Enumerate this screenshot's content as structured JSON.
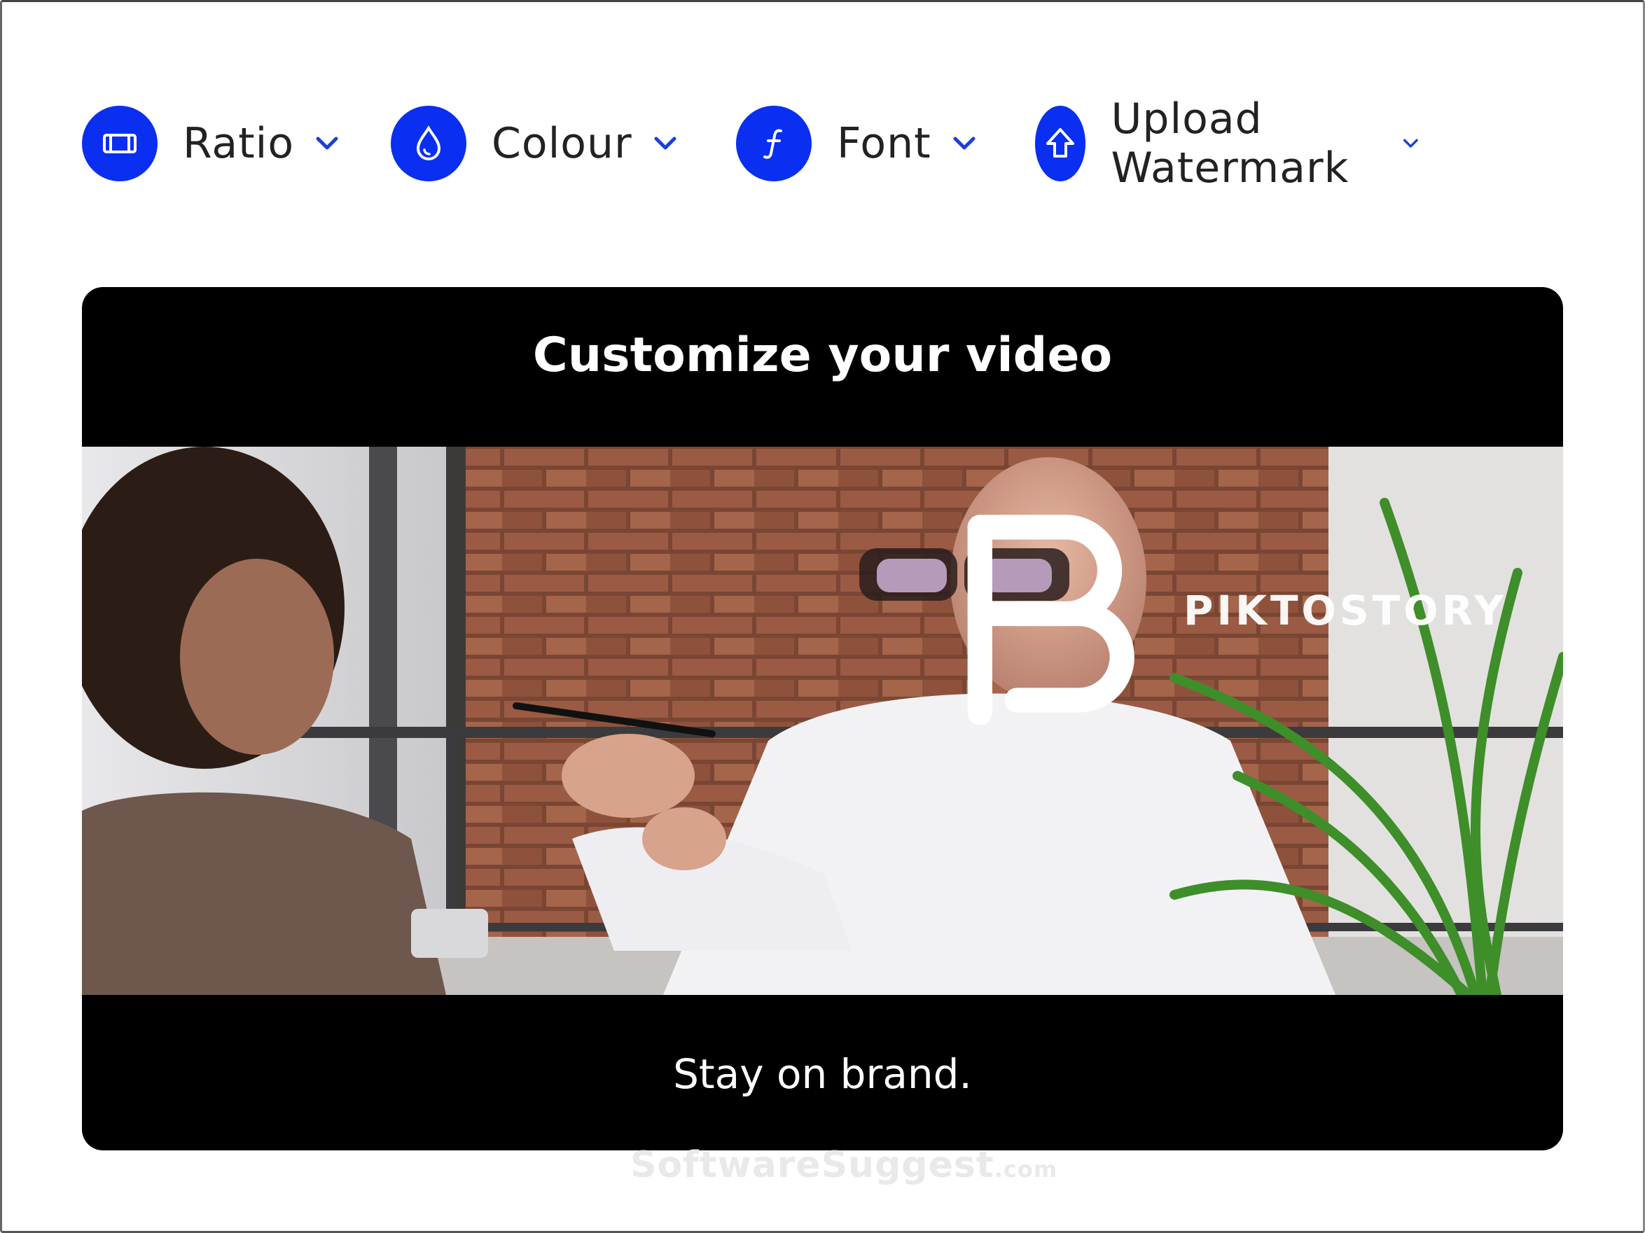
{
  "toolbar": {
    "items": [
      {
        "label": "Ratio",
        "icon": "ratio-icon"
      },
      {
        "label": "Colour",
        "icon": "droplet-icon"
      },
      {
        "label": "Font",
        "icon": "font-icon"
      },
      {
        "label": "Upload Watermark",
        "icon": "upload-arrow-icon"
      }
    ]
  },
  "card": {
    "title": "Customize your video",
    "caption": "Stay on brand.",
    "watermark": "PIKTOSTORY"
  },
  "site_watermark": {
    "name": "SoftwareSuggest",
    "suffix": ".com"
  },
  "colors": {
    "accent": "#0a2ff0",
    "card_background": "#000000",
    "chevron": "#1a3fd8"
  }
}
